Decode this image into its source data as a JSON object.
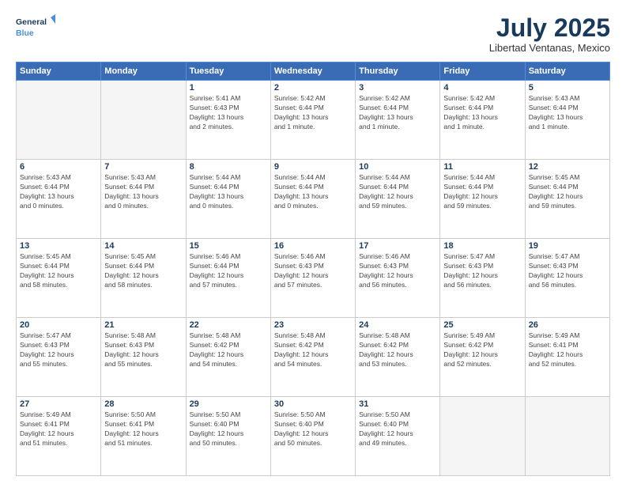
{
  "header": {
    "logo_line1": "General",
    "logo_line2": "Blue",
    "title": "July 2025",
    "location": "Libertad Ventanas, Mexico"
  },
  "weekdays": [
    "Sunday",
    "Monday",
    "Tuesday",
    "Wednesday",
    "Thursday",
    "Friday",
    "Saturday"
  ],
  "weeks": [
    [
      {
        "day": "",
        "info": ""
      },
      {
        "day": "",
        "info": ""
      },
      {
        "day": "1",
        "info": "Sunrise: 5:41 AM\nSunset: 6:43 PM\nDaylight: 13 hours\nand 2 minutes."
      },
      {
        "day": "2",
        "info": "Sunrise: 5:42 AM\nSunset: 6:44 PM\nDaylight: 13 hours\nand 1 minute."
      },
      {
        "day": "3",
        "info": "Sunrise: 5:42 AM\nSunset: 6:44 PM\nDaylight: 13 hours\nand 1 minute."
      },
      {
        "day": "4",
        "info": "Sunrise: 5:42 AM\nSunset: 6:44 PM\nDaylight: 13 hours\nand 1 minute."
      },
      {
        "day": "5",
        "info": "Sunrise: 5:43 AM\nSunset: 6:44 PM\nDaylight: 13 hours\nand 1 minute."
      }
    ],
    [
      {
        "day": "6",
        "info": "Sunrise: 5:43 AM\nSunset: 6:44 PM\nDaylight: 13 hours\nand 0 minutes."
      },
      {
        "day": "7",
        "info": "Sunrise: 5:43 AM\nSunset: 6:44 PM\nDaylight: 13 hours\nand 0 minutes."
      },
      {
        "day": "8",
        "info": "Sunrise: 5:44 AM\nSunset: 6:44 PM\nDaylight: 13 hours\nand 0 minutes."
      },
      {
        "day": "9",
        "info": "Sunrise: 5:44 AM\nSunset: 6:44 PM\nDaylight: 13 hours\nand 0 minutes."
      },
      {
        "day": "10",
        "info": "Sunrise: 5:44 AM\nSunset: 6:44 PM\nDaylight: 12 hours\nand 59 minutes."
      },
      {
        "day": "11",
        "info": "Sunrise: 5:44 AM\nSunset: 6:44 PM\nDaylight: 12 hours\nand 59 minutes."
      },
      {
        "day": "12",
        "info": "Sunrise: 5:45 AM\nSunset: 6:44 PM\nDaylight: 12 hours\nand 59 minutes."
      }
    ],
    [
      {
        "day": "13",
        "info": "Sunrise: 5:45 AM\nSunset: 6:44 PM\nDaylight: 12 hours\nand 58 minutes."
      },
      {
        "day": "14",
        "info": "Sunrise: 5:45 AM\nSunset: 6:44 PM\nDaylight: 12 hours\nand 58 minutes."
      },
      {
        "day": "15",
        "info": "Sunrise: 5:46 AM\nSunset: 6:44 PM\nDaylight: 12 hours\nand 57 minutes."
      },
      {
        "day": "16",
        "info": "Sunrise: 5:46 AM\nSunset: 6:43 PM\nDaylight: 12 hours\nand 57 minutes."
      },
      {
        "day": "17",
        "info": "Sunrise: 5:46 AM\nSunset: 6:43 PM\nDaylight: 12 hours\nand 56 minutes."
      },
      {
        "day": "18",
        "info": "Sunrise: 5:47 AM\nSunset: 6:43 PM\nDaylight: 12 hours\nand 56 minutes."
      },
      {
        "day": "19",
        "info": "Sunrise: 5:47 AM\nSunset: 6:43 PM\nDaylight: 12 hours\nand 56 minutes."
      }
    ],
    [
      {
        "day": "20",
        "info": "Sunrise: 5:47 AM\nSunset: 6:43 PM\nDaylight: 12 hours\nand 55 minutes."
      },
      {
        "day": "21",
        "info": "Sunrise: 5:48 AM\nSunset: 6:43 PM\nDaylight: 12 hours\nand 55 minutes."
      },
      {
        "day": "22",
        "info": "Sunrise: 5:48 AM\nSunset: 6:42 PM\nDaylight: 12 hours\nand 54 minutes."
      },
      {
        "day": "23",
        "info": "Sunrise: 5:48 AM\nSunset: 6:42 PM\nDaylight: 12 hours\nand 54 minutes."
      },
      {
        "day": "24",
        "info": "Sunrise: 5:48 AM\nSunset: 6:42 PM\nDaylight: 12 hours\nand 53 minutes."
      },
      {
        "day": "25",
        "info": "Sunrise: 5:49 AM\nSunset: 6:42 PM\nDaylight: 12 hours\nand 52 minutes."
      },
      {
        "day": "26",
        "info": "Sunrise: 5:49 AM\nSunset: 6:41 PM\nDaylight: 12 hours\nand 52 minutes."
      }
    ],
    [
      {
        "day": "27",
        "info": "Sunrise: 5:49 AM\nSunset: 6:41 PM\nDaylight: 12 hours\nand 51 minutes."
      },
      {
        "day": "28",
        "info": "Sunrise: 5:50 AM\nSunset: 6:41 PM\nDaylight: 12 hours\nand 51 minutes."
      },
      {
        "day": "29",
        "info": "Sunrise: 5:50 AM\nSunset: 6:40 PM\nDaylight: 12 hours\nand 50 minutes."
      },
      {
        "day": "30",
        "info": "Sunrise: 5:50 AM\nSunset: 6:40 PM\nDaylight: 12 hours\nand 50 minutes."
      },
      {
        "day": "31",
        "info": "Sunrise: 5:50 AM\nSunset: 6:40 PM\nDaylight: 12 hours\nand 49 minutes."
      },
      {
        "day": "",
        "info": ""
      },
      {
        "day": "",
        "info": ""
      }
    ]
  ]
}
